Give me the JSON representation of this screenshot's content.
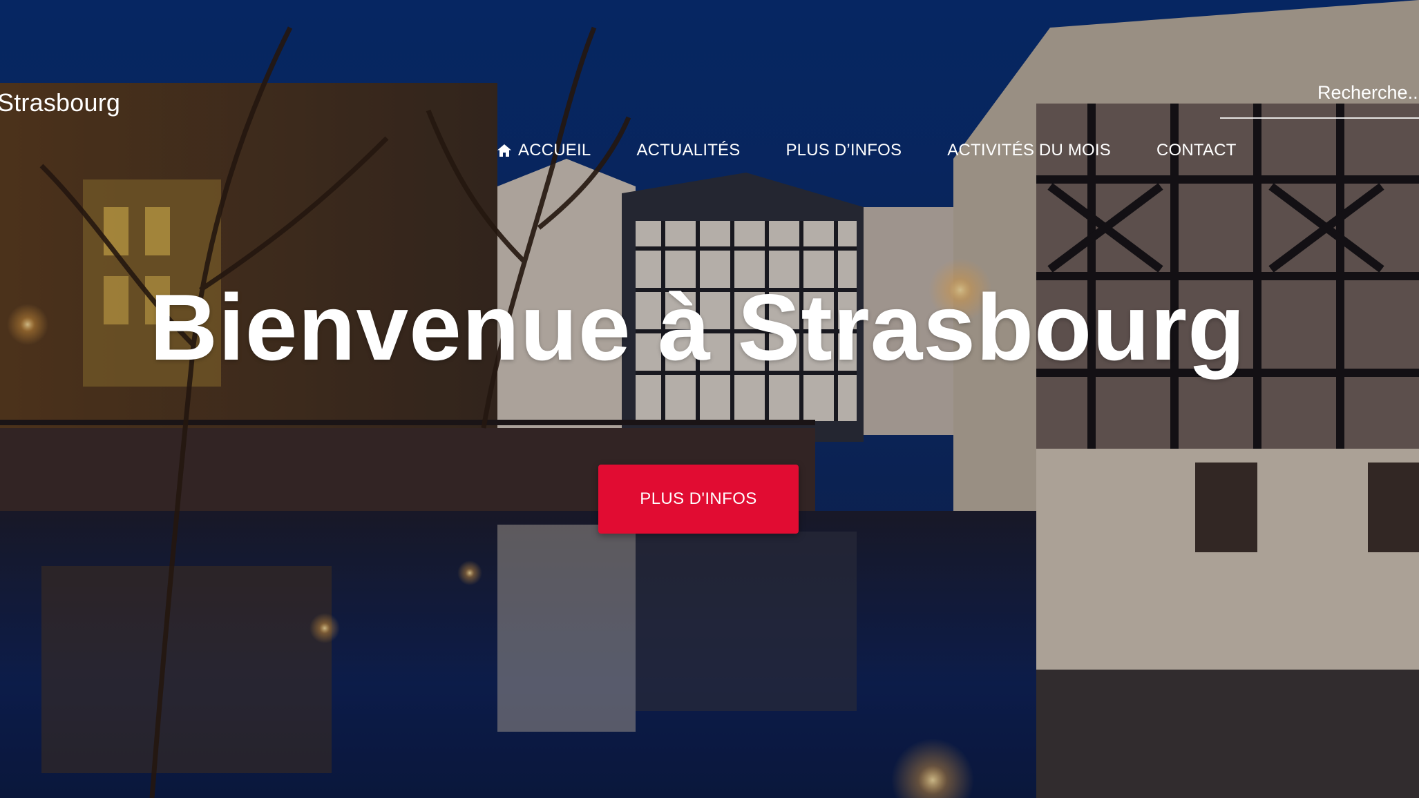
{
  "site": {
    "title": "Strasbourg"
  },
  "search": {
    "placeholder": "Recherche..."
  },
  "nav": {
    "items": [
      {
        "label": "ACCUEIL",
        "icon": "home-icon"
      },
      {
        "label": "ACTUALITÉS"
      },
      {
        "label": "PLUS D’INFOS"
      },
      {
        "label": "ACTIVITÉS DU MOIS"
      },
      {
        "label": "CONTACT"
      }
    ]
  },
  "hero": {
    "heading": "Bienvenue à Strasbourg",
    "cta_label": "PLUS D'INFOS"
  },
  "colors": {
    "cta": "#e10c32",
    "sky": "#0b2a66",
    "text": "#ffffff"
  }
}
